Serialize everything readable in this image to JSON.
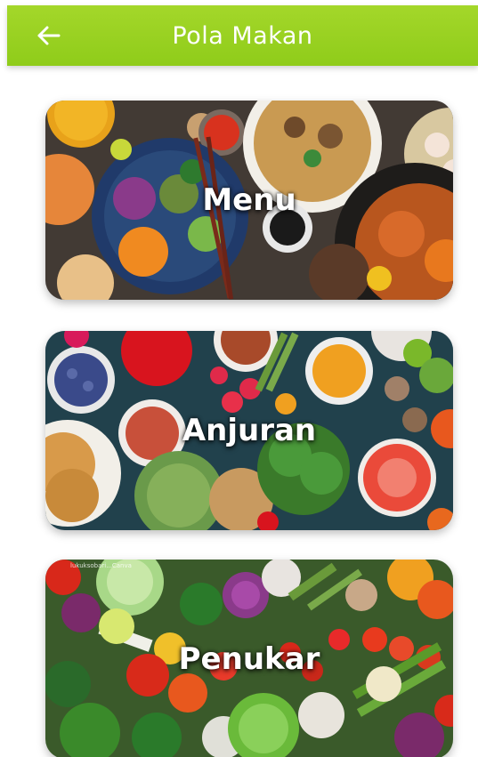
{
  "appbar": {
    "title": "Pola Makan",
    "back_icon": "arrow-left-icon",
    "color": "#96d020"
  },
  "cards": [
    {
      "label": "Menu"
    },
    {
      "label": "Anjuran"
    },
    {
      "label": "Penukar",
      "watermark": "lukuksobari...Canva"
    }
  ]
}
